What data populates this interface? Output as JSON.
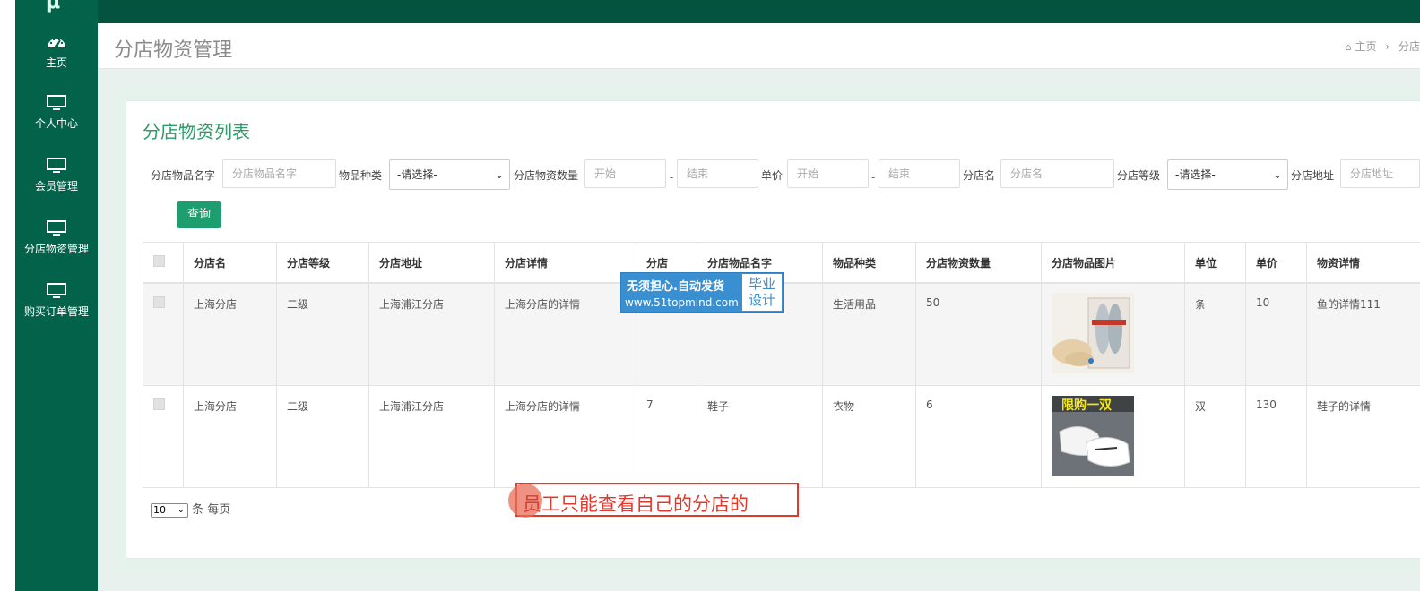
{
  "sidebar": {
    "logo": "μ",
    "items": [
      {
        "label": "主页",
        "icon": "dashboard-icon"
      },
      {
        "label": "个人中心",
        "icon": "monitor-icon"
      },
      {
        "label": "会员管理",
        "icon": "monitor-icon"
      },
      {
        "label": "分店物资管理",
        "icon": "monitor-icon"
      },
      {
        "label": "购买订单管理",
        "icon": "monitor-icon"
      }
    ]
  },
  "header": {
    "page_title": "分店物资管理",
    "breadcrumb_home": "主页",
    "breadcrumb_sep": "›",
    "breadcrumb_current": "分店"
  },
  "panel": {
    "heading": "分店物资列表"
  },
  "filters": {
    "item_name_label": "分店物品名字",
    "item_name_placeholder": "分店物品名字",
    "category_label": "物品种类",
    "category_value": "-请选择-",
    "quantity_label": "分店物资数量",
    "start_placeholder": "开始",
    "end_placeholder": "结束",
    "dash": "-",
    "price_label": "单价",
    "store_name_label": "分店名",
    "store_name_placeholder": "分店名",
    "store_level_label": "分店等级",
    "store_level_value": "-请选择-",
    "address_label": "分店地址",
    "address_placeholder": "分店地址",
    "query_button": "查询"
  },
  "table": {
    "headers": [
      "分店名",
      "分店等级",
      "分店地址",
      "分店详情",
      "分店",
      "分店物品名字",
      "物品种类",
      "分店物资数量",
      "分店物品图片",
      "单位",
      "单价",
      "物资详情"
    ],
    "rows": [
      {
        "store": "上海分店",
        "level": "二级",
        "address": "上海浦江分店",
        "detail": "上海分店的详情",
        "branch": "",
        "item": "",
        "category": "生活用品",
        "qty": "50",
        "unit": "条",
        "price": "10",
        "item_detail": "鱼的详情111"
      },
      {
        "store": "上海分店",
        "level": "二级",
        "address": "上海浦江分店",
        "detail": "上海分店的详情",
        "branch": "7",
        "item": "鞋子",
        "category": "衣物",
        "qty": "6",
        "unit": "双",
        "price": "130",
        "item_detail": "鞋子的详情"
      }
    ],
    "row2_image_caption": "限购一双"
  },
  "pager": {
    "page_size": "10",
    "per_page_label": "条 每页"
  },
  "watermark": {
    "line1": "无须担心.自动发货",
    "line2": "www.51topmind.com",
    "box_line1": "毕业",
    "box_line2": "设计"
  },
  "annotation": {
    "text": "员工只能查看自己的分店的"
  },
  "colors": {
    "sidebar": "#02634a",
    "topbar": "#03533f",
    "accent": "#1e9e6e",
    "heading": "#2f9a6a"
  }
}
